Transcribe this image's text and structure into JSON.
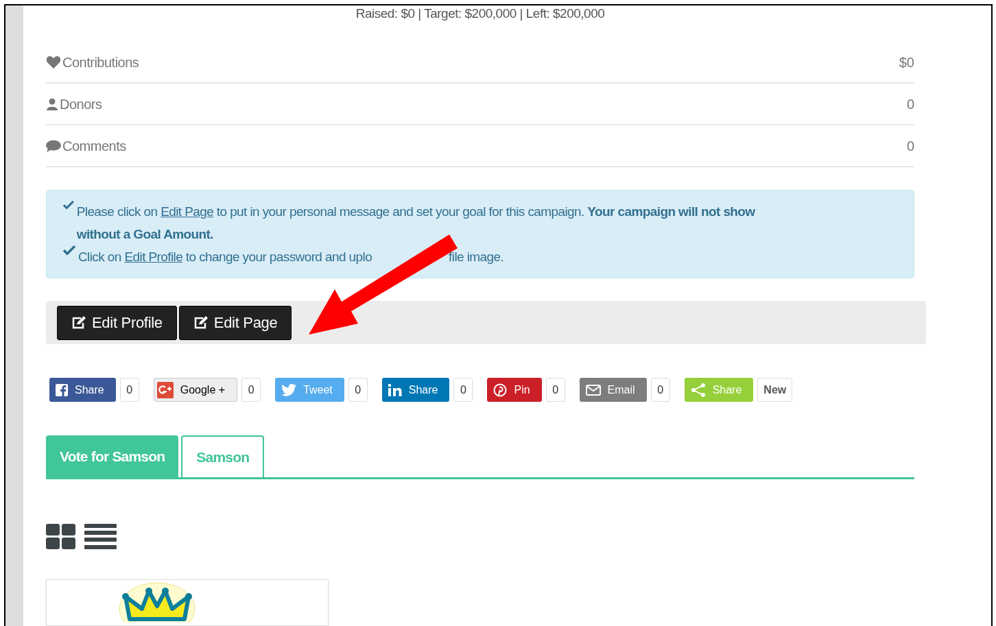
{
  "summary": "Raised: $0 | Target: $200,000 | Left: $200,000",
  "stats": [
    {
      "kind": "heart",
      "label": "Contributions",
      "value": "$0"
    },
    {
      "kind": "user",
      "label": "Donors",
      "value": "0"
    },
    {
      "kind": "comment",
      "label": "Comments",
      "value": "0"
    }
  ],
  "notice": {
    "lines": [
      {
        "before": "Please click on ",
        "link": "Edit Page",
        "after": " to put in your personal message and set your goal for this campaign. **Your campaign will not show without a Goal Amount.**"
      },
      {
        "before": "Click on ",
        "link": "Edit Profile",
        "after": " to change your password and uplo",
        "after_arrow": "file image."
      }
    ]
  },
  "edit_buttons": [
    "Edit Profile",
    "Edit Page"
  ],
  "share_buttons": [
    {
      "kind": "facebook",
      "label": "Share",
      "count": "0",
      "color": "#3b5998"
    },
    {
      "kind": "google",
      "label": "Google +",
      "count": "0",
      "color": "#eeeeee"
    },
    {
      "kind": "twitter",
      "label": "Tweet",
      "count": "0",
      "color": "#55acee"
    },
    {
      "kind": "linkedin",
      "label": "Share",
      "count": "0",
      "color": "#0077b5"
    },
    {
      "kind": "pinterest",
      "label": "Pin",
      "count": "0",
      "color": "#cb2027"
    },
    {
      "kind": "email",
      "label": "Email",
      "count": "0",
      "color": "#7d7d7d"
    },
    {
      "kind": "share",
      "label": "Share",
      "count": "New",
      "color": "#95d03a"
    }
  ],
  "tabs": [
    {
      "label": "Vote for Samson",
      "selected": true
    },
    {
      "label": "Samson",
      "selected": false
    }
  ]
}
